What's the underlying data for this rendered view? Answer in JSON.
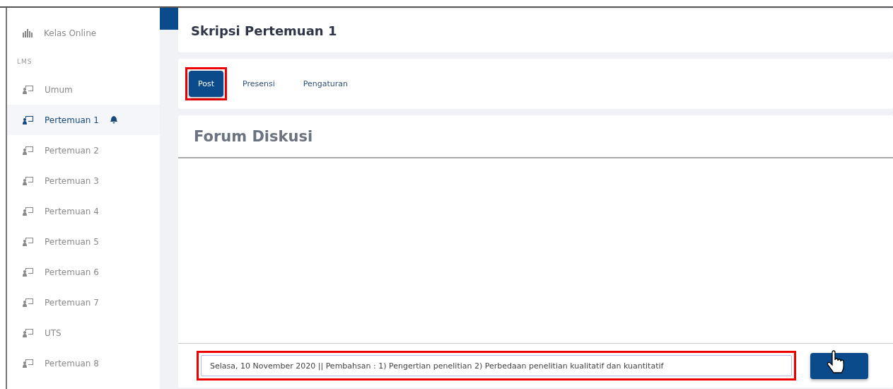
{
  "sidebar": {
    "items": [
      {
        "kind": "class",
        "label": "Kelas Online",
        "selected": false,
        "notification": false
      },
      {
        "kind": "heading",
        "label": "LMS"
      },
      {
        "kind": "item",
        "label": "Umum",
        "selected": false,
        "notification": false
      },
      {
        "kind": "item",
        "label": "Pertemuan 1",
        "selected": true,
        "notification": true
      },
      {
        "kind": "item",
        "label": "Pertemuan 2",
        "selected": false,
        "notification": false
      },
      {
        "kind": "item",
        "label": "Pertemuan 3",
        "selected": false,
        "notification": false
      },
      {
        "kind": "item",
        "label": "Pertemuan 4",
        "selected": false,
        "notification": false
      },
      {
        "kind": "item",
        "label": "Pertemuan 5",
        "selected": false,
        "notification": false
      },
      {
        "kind": "item",
        "label": "Pertemuan 6",
        "selected": false,
        "notification": false
      },
      {
        "kind": "item",
        "label": "Pertemuan 7",
        "selected": false,
        "notification": false
      },
      {
        "kind": "item",
        "label": "UTS",
        "selected": false,
        "notification": false
      },
      {
        "kind": "item",
        "label": "Pertemuan 8",
        "selected": false,
        "notification": false
      }
    ]
  },
  "page": {
    "title": "Skripsi Pertemuan 1"
  },
  "tabs": [
    {
      "label": "Post",
      "selected": true,
      "highlighted": true
    },
    {
      "label": "Presensi",
      "selected": false,
      "highlighted": false
    },
    {
      "label": "Pengaturan",
      "selected": false,
      "highlighted": false
    }
  ],
  "forum": {
    "title": "Forum Diskusi",
    "message": {
      "value": "Selasa, 10 November 2020 || Pembahsan : 1) Pengertian penelitian 2) Perbedaan penelitian kualitatif dan kuantitatif",
      "highlighted": true
    }
  }
}
